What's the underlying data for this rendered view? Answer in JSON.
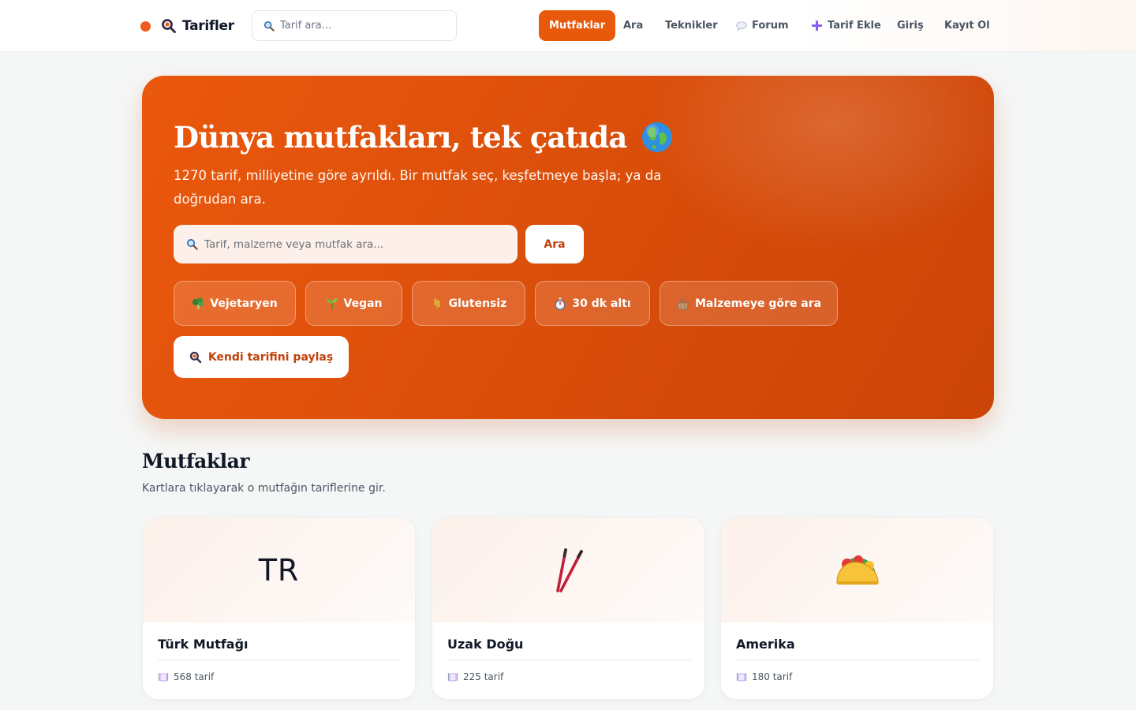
{
  "header": {
    "brand": "Tarifler",
    "search_placeholder": "Tarif ara...",
    "nav": [
      {
        "label": "Mutfaklar",
        "active": true
      },
      {
        "label": "Ara"
      },
      {
        "label": "Teknikler"
      },
      {
        "label": "Forum",
        "icon": "speech-bubble-icon"
      },
      {
        "label": "Tarif Ekle",
        "icon": "plus-icon"
      },
      {
        "label": "Giriş"
      },
      {
        "label": "Kayıt Ol"
      }
    ]
  },
  "hero": {
    "title": "Dünya mutfakları, tek çatıda",
    "title_icon": "globe-icon",
    "subtitle": "1270 tarif, milliyetine göre ayrıldı. Bir mutfak seç, keşfetmeye başla; ya da doğrudan ara.",
    "search_placeholder": "Tarif, malzeme veya mutfak ara...",
    "search_button": "Ara",
    "chips": [
      {
        "label": "Vejetaryen",
        "icon": "broccoli-icon"
      },
      {
        "label": "Vegan",
        "icon": "seedling-icon"
      },
      {
        "label": "Glutensiz",
        "icon": "wheat-icon"
      },
      {
        "label": "30 dk altı",
        "icon": "stopwatch-icon"
      },
      {
        "label": "Malzemeye göre ara",
        "icon": "basket-icon"
      }
    ],
    "share_button": "Kendi tarifini paylaş"
  },
  "section": {
    "title": "Mutfaklar",
    "subtitle": "Kartlara tıklayarak o mutfağın tariflerine gir."
  },
  "cuisines": [
    {
      "name": "Türk Mutfağı",
      "visual": "TR",
      "count": "568 tarif"
    },
    {
      "name": "Uzak Doğu",
      "visual": "chopsticks-icon",
      "count": "225 tarif"
    },
    {
      "name": "Amerika",
      "visual": "taco-icon",
      "count": "180 tarif"
    }
  ],
  "colors": {
    "accent": "#e8590c",
    "hero_gradient_start": "#ea580c",
    "hero_gradient_end": "#cb4407",
    "background": "#f5f7f6"
  }
}
